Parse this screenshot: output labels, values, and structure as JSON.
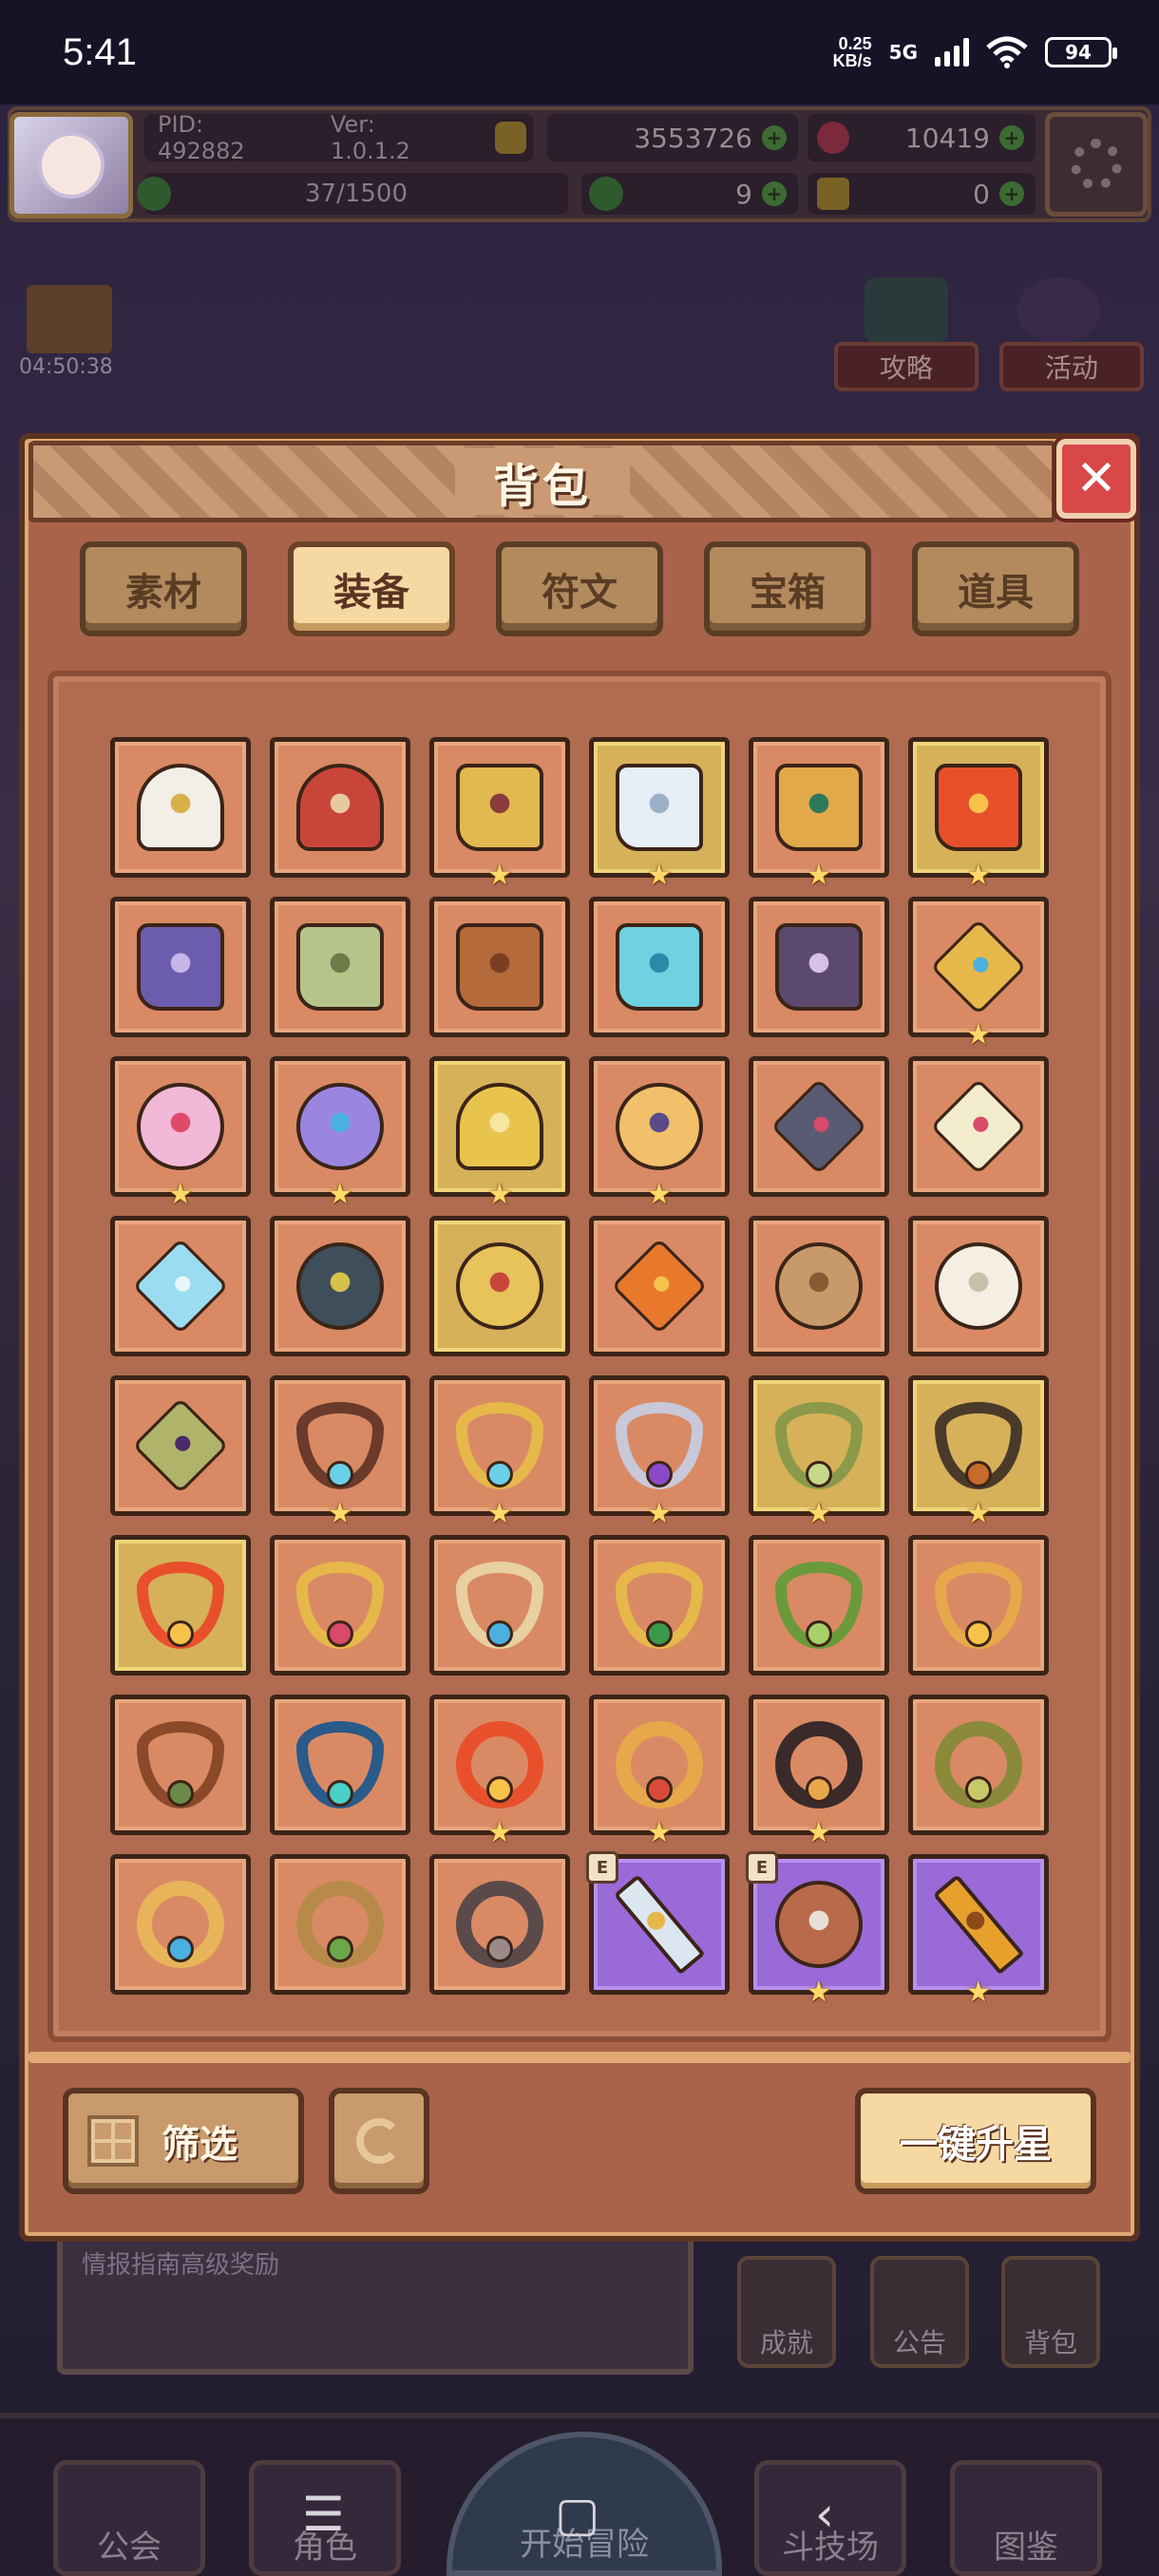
{
  "status_bar": {
    "time": "5:41",
    "net_speed_top": "0.25",
    "net_speed_bottom": "KB/s",
    "network": "5G",
    "battery": "94"
  },
  "top_bar": {
    "pid": "PID: 492882",
    "version": "Ver: 1.0.1.2",
    "gold": "3553726",
    "gems": "10419",
    "stamina": "37/1500",
    "clover_count": "9",
    "key_count": "0"
  },
  "scene": {
    "gift_timer": "04:50:38",
    "guide_button": "攻略",
    "event_button": "活动",
    "banner_text": "情报指南高级奖励",
    "achievement_button": "成就",
    "notice_button": "公告",
    "bag_button": "背包",
    "nav": {
      "guild": "公会",
      "character": "角色",
      "start": "开始冒险",
      "arena": "斗技场",
      "codex": "图鉴"
    },
    "system_nav": {
      "menu": "☰",
      "home": "▢",
      "back": "‹"
    }
  },
  "backpack": {
    "title": "背包",
    "close_icon": "close-icon",
    "tabs": [
      "素材",
      "装备",
      "符文",
      "宝箱",
      "道具"
    ],
    "active_tab": "装备",
    "filter_label": "筛选",
    "upstar_label": "一键升星",
    "badge_letter": "E",
    "items": [
      {
        "name": "white-gold-helmet",
        "kind": "helm",
        "color": "#f2efe6",
        "accent": "#d8b04a",
        "slot": "normal",
        "star": false
      },
      {
        "name": "red-crown-helmet",
        "kind": "helm",
        "color": "#c8453a",
        "accent": "#e7c9a0",
        "slot": "normal",
        "star": false
      },
      {
        "name": "golden-boots",
        "kind": "boots",
        "color": "#e2b94e",
        "accent": "#8a3c3c",
        "slot": "normal",
        "star": true
      },
      {
        "name": "silver-boots",
        "kind": "boots",
        "color": "#e6eef6",
        "accent": "#9ab0c8",
        "slot": "gold",
        "star": true
      },
      {
        "name": "jeweled-gold-boots",
        "kind": "boots",
        "color": "#e2a94a",
        "accent": "#2d7a5a",
        "slot": "normal",
        "star": true
      },
      {
        "name": "flame-boots",
        "kind": "boots",
        "color": "#e8502c",
        "accent": "#f6c24a",
        "slot": "gold",
        "star": true
      },
      {
        "name": "purple-boots",
        "kind": "boots",
        "color": "#6c5cae",
        "accent": "#c7b6e8",
        "slot": "normal",
        "star": false
      },
      {
        "name": "green-leather-boots",
        "kind": "boots",
        "color": "#b6c48a",
        "accent": "#6d7a4a",
        "slot": "normal",
        "star": false
      },
      {
        "name": "brown-boots",
        "kind": "boots",
        "color": "#b56a3c",
        "accent": "#7a3e22",
        "slot": "normal",
        "star": false
      },
      {
        "name": "ice-boots",
        "kind": "boots",
        "color": "#6fd2e0",
        "accent": "#2a8aa8",
        "slot": "normal",
        "star": false
      },
      {
        "name": "shadow-boots",
        "kind": "boots",
        "color": "#5c4a6e",
        "accent": "#d6c0e6",
        "slot": "normal",
        "star": false
      },
      {
        "name": "gold-rune-gem",
        "kind": "gem",
        "color": "#e6b84a",
        "accent": "#4ab0e0",
        "slot": "normal",
        "star": true
      },
      {
        "name": "pink-heart-charm",
        "kind": "flower",
        "color": "#f2b8d8",
        "accent": "#e04a6a",
        "slot": "normal",
        "star": true
      },
      {
        "name": "violet-flower-charm",
        "kind": "flower",
        "color": "#9a86e0",
        "accent": "#4ab0e0",
        "slot": "normal",
        "star": true
      },
      {
        "name": "golden-shield",
        "kind": "helm",
        "color": "#e8c44e",
        "accent": "#f6e6a0",
        "slot": "gold",
        "star": true
      },
      {
        "name": "sun-flower-charm",
        "kind": "flower",
        "color": "#f2c06a",
        "accent": "#5a4a8a",
        "slot": "normal",
        "star": true
      },
      {
        "name": "dark-crest",
        "kind": "gem",
        "color": "#5a5a72",
        "accent": "#d84a6a",
        "slot": "normal",
        "star": false
      },
      {
        "name": "cross-crystal",
        "kind": "gem",
        "color": "#f2eccc",
        "accent": "#d84a6a",
        "slot": "normal",
        "star": false
      },
      {
        "name": "ice-crystal",
        "kind": "gem",
        "color": "#9adcf0",
        "accent": "#e8f6fc",
        "slot": "normal",
        "star": false
      },
      {
        "name": "dark-orb-amulet",
        "kind": "round",
        "color": "#3e4e5a",
        "accent": "#d6c24a",
        "slot": "normal",
        "star": false
      },
      {
        "name": "gold-sigil",
        "kind": "round",
        "color": "#e8c25a",
        "accent": "#c8453a",
        "slot": "gold",
        "star": false
      },
      {
        "name": "amber-gem",
        "kind": "gem",
        "color": "#e8782c",
        "accent": "#f6c24a",
        "slot": "normal",
        "star": false
      },
      {
        "name": "bronze-shell",
        "kind": "round",
        "color": "#c89a6a",
        "accent": "#8a5a34",
        "slot": "normal",
        "star": false
      },
      {
        "name": "pearl-shell",
        "kind": "flower",
        "color": "#f4efe2",
        "accent": "#c8c0a8",
        "slot": "normal",
        "star": false
      },
      {
        "name": "emerald-amulet",
        "kind": "gem",
        "color": "#b0b46a",
        "accent": "#4a2a6a",
        "slot": "normal",
        "star": false
      },
      {
        "name": "sapphire-necklace",
        "kind": "neck",
        "color": "#6a3a2a",
        "accent": "#6ad0e8",
        "slot": "normal",
        "star": true
      },
      {
        "name": "gold-aqua-necklace",
        "kind": "neck",
        "color": "#e6b84a",
        "accent": "#6ad0e8",
        "slot": "normal",
        "star": true
      },
      {
        "name": "silver-amethyst-necklace",
        "kind": "neck",
        "color": "#c8c8d8",
        "accent": "#8a4ac8",
        "slot": "normal",
        "star": true
      },
      {
        "name": "jade-necklace",
        "kind": "neck",
        "color": "#8a9a4a",
        "accent": "#c8d88a",
        "slot": "gold",
        "star": true
      },
      {
        "name": "amber-drop-necklace",
        "kind": "neck",
        "color": "#4a3a2a",
        "accent": "#c86a2a",
        "slot": "gold",
        "star": true
      },
      {
        "name": "fire-heart-necklace",
        "kind": "neck",
        "color": "#e8502c",
        "accent": "#f6c24a",
        "slot": "gold",
        "star": false
      },
      {
        "name": "ruby-gold-necklace",
        "kind": "neck",
        "color": "#e6b84a",
        "accent": "#d84a6a",
        "slot": "normal",
        "star": false
      },
      {
        "name": "topaz-silver-necklace",
        "kind": "neck",
        "color": "#e8d0a0",
        "accent": "#4ab0e0",
        "slot": "normal",
        "star": false
      },
      {
        "name": "emerald-gold-necklace",
        "kind": "neck",
        "color": "#e6b84a",
        "accent": "#3a9a4a",
        "slot": "normal",
        "star": false
      },
      {
        "name": "leaf-necklace",
        "kind": "neck",
        "color": "#6a9a3a",
        "accent": "#a8d06a",
        "slot": "normal",
        "star": false
      },
      {
        "name": "gold-heart-necklace",
        "kind": "neck",
        "color": "#e6a84a",
        "accent": "#f6c24a",
        "slot": "normal",
        "star": false
      },
      {
        "name": "bronze-heart-necklace",
        "kind": "neck",
        "color": "#8a4a2a",
        "accent": "#6a8a4a",
        "slot": "normal",
        "star": false
      },
      {
        "name": "teal-necklace",
        "kind": "neck",
        "color": "#2a5a8a",
        "accent": "#4ad0c8",
        "slot": "normal",
        "star": false
      },
      {
        "name": "flame-ring",
        "kind": "ring",
        "color": "#e8502c",
        "accent": "#f6c24a",
        "slot": "normal",
        "star": true
      },
      {
        "name": "ruby-gold-ring",
        "kind": "ring",
        "color": "#e6a84a",
        "accent": "#d84a3a",
        "slot": "normal",
        "star": true
      },
      {
        "name": "obsidian-ring",
        "kind": "ring",
        "color": "#3a2a2a",
        "accent": "#e8a84a",
        "slot": "normal",
        "star": true
      },
      {
        "name": "serpent-ring",
        "kind": "ring",
        "color": "#8a8a3a",
        "accent": "#c8c86a",
        "slot": "normal",
        "star": false
      },
      {
        "name": "winged-ring",
        "kind": "ring",
        "color": "#e8b45a",
        "accent": "#4ab0e0",
        "slot": "normal",
        "star": false
      },
      {
        "name": "crown-ring",
        "kind": "ring",
        "color": "#b88a4a",
        "accent": "#6aa84a",
        "slot": "normal",
        "star": false
      },
      {
        "name": "stone-ring",
        "kind": "ring",
        "color": "#5a4a4a",
        "accent": "#9a8a8a",
        "slot": "normal",
        "star": false
      },
      {
        "name": "silver-sword",
        "kind": "sword",
        "color": "#dce6f0",
        "accent": "#e6b84a",
        "slot": "purple",
        "star": false,
        "badge": true
      },
      {
        "name": "copper-orb",
        "kind": "round",
        "color": "#b86a4a",
        "accent": "#e8e0d8",
        "slot": "purple",
        "star": true,
        "badge": true
      },
      {
        "name": "golden-dagger",
        "kind": "sword",
        "color": "#e8a02c",
        "accent": "#8a4a1a",
        "slot": "purple",
        "star": true,
        "badge": false
      }
    ]
  },
  "colors": {
    "panel": "#a8634a",
    "slot_normal": "#d98a64",
    "slot_gold": "#d6b15a",
    "slot_purple": "#9a6ad8",
    "star": "#ffd86a",
    "close_button": "#d84848"
  }
}
